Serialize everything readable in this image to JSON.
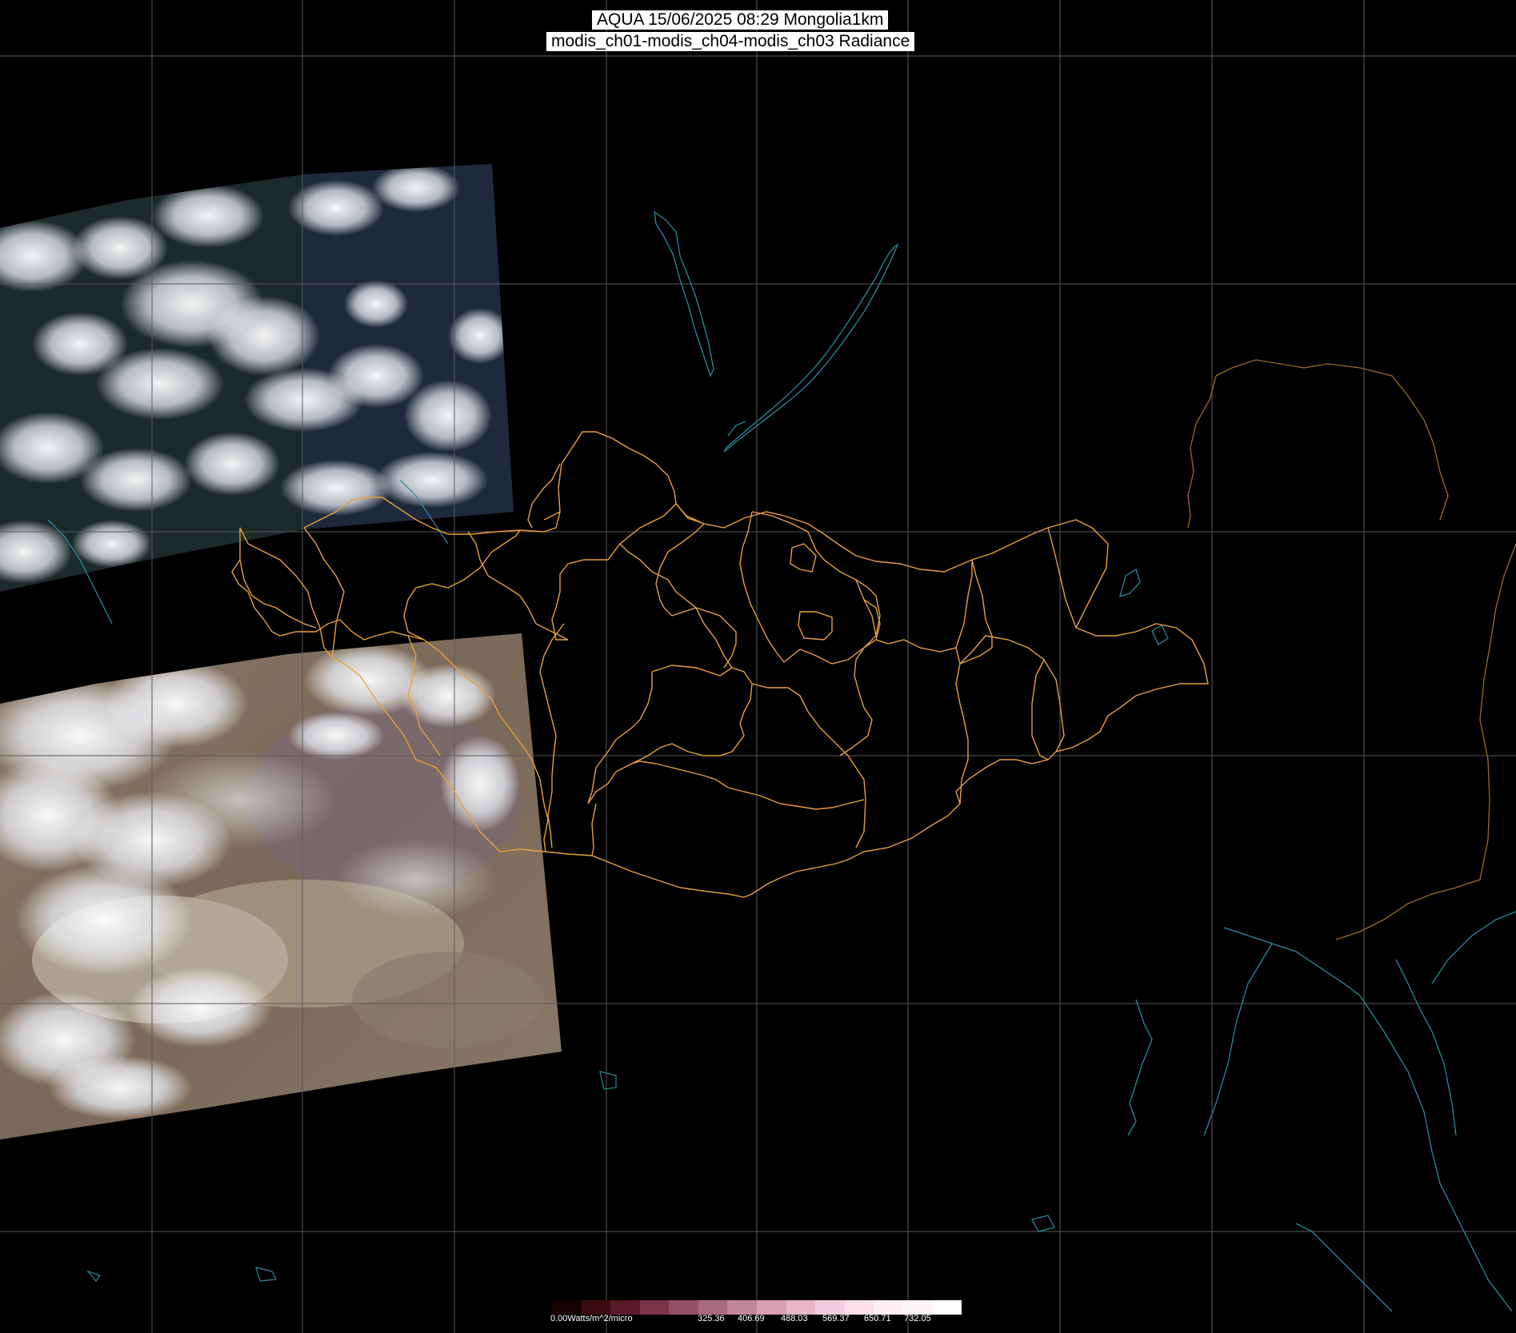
{
  "title": {
    "line1": "AQUA 15/06/2025 08:29 Mongolia1km",
    "line2": "modis_ch01-modis_ch04-modis_ch03 Radiance"
  },
  "colorbar": {
    "unit_label": "0.00Watts/m^2/micro",
    "tick_labels": [
      "325.36",
      "406.69",
      "488.03",
      "569.37",
      "650.71",
      "732.05"
    ],
    "colors": [
      "#150000",
      "#3a0a10",
      "#5a1a2a",
      "#7a3448",
      "#935066",
      "#a86a80",
      "#c08898",
      "#d8a0b2",
      "#e8b8c8",
      "#f4cede",
      "#fbe0ec",
      "#ffeef6",
      "#fff6fb",
      "#ffffff"
    ]
  },
  "colors": {
    "background": "#000000",
    "graticule": "#5a5a5a",
    "province_border": "#e8a040",
    "coastline": "#2a8a9a",
    "border_brown": "#9a6a30"
  }
}
